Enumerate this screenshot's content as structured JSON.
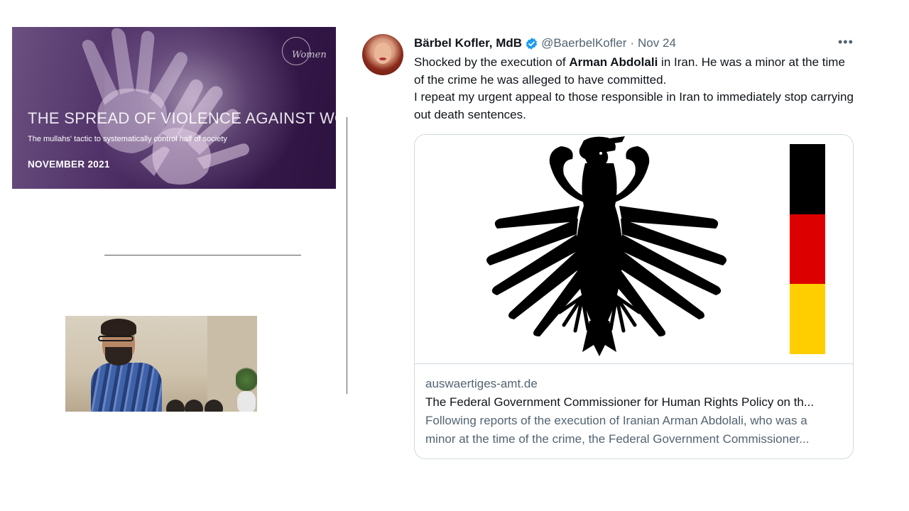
{
  "report_banner": {
    "title": "THE SPREAD OF VIOLENCE AGAINST WOMEN",
    "subtitle": "The mullahs' tactic to systematically control half of society",
    "date": "NOVEMBER 2021",
    "logo_text": "Women"
  },
  "tweet": {
    "author_name": "Bärbel Kofler, MdB",
    "handle": "@BaerbelKofler",
    "separator": "·",
    "date": "Nov 24",
    "more_label": "•••",
    "text": {
      "part1": "Shocked by the execution of ",
      "bold_name": "Arman Abdolali",
      "part2": " in Iran. He was a minor at the time of the crime he was alleged to have committed.",
      "part3": "I repeat my urgent appeal to those responsible in Iran to immediately stop carrying out death sentences."
    },
    "card": {
      "domain": "auswaertiges-amt.de",
      "title": "The Federal Government Commissioner for Human Rights Policy on th...",
      "description_line1": "Following reports of the execution of Iranian Arman Abdolali, who was a",
      "description_line2": "minor at the time of the crime, the Federal Government Commissioner..."
    }
  },
  "icons": {
    "verified": "verified-badge-icon",
    "more": "more-options-icon",
    "eagle": "federal-eagle-icon"
  },
  "colors": {
    "banner_purple": "#3a1c50",
    "verified_blue": "#1d9bf0",
    "flag_black": "#000000",
    "flag_red": "#dd0000",
    "flag_gold": "#ffce00"
  }
}
